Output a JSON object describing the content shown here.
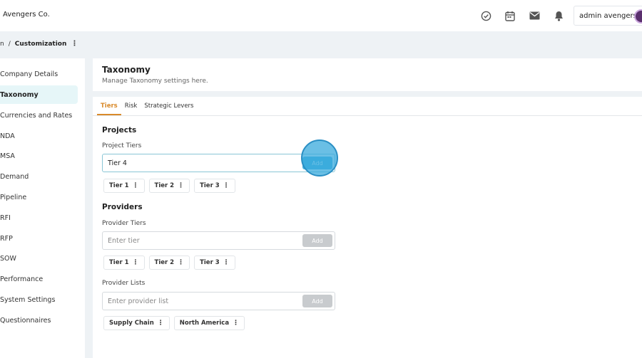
{
  "app": {
    "company": "Avengers Co.",
    "user": "admin avengers"
  },
  "top_icons": [
    "check-circle-icon",
    "calendar-icon",
    "mail-icon",
    "bell-icon"
  ],
  "breadcrumb": {
    "prev": "n",
    "sep": "/",
    "current": "Customization",
    "menu": "⋮"
  },
  "sidebar": {
    "items": [
      {
        "label": "Company Details"
      },
      {
        "label": "Taxonomy",
        "active": true
      },
      {
        "label": "Currencies and Rates"
      },
      {
        "label": "NDA"
      },
      {
        "label": "MSA"
      },
      {
        "label": "Demand"
      },
      {
        "label": "Pipeline"
      },
      {
        "label": "RFI"
      },
      {
        "label": "RFP"
      },
      {
        "label": "SOW"
      },
      {
        "label": "Performance"
      },
      {
        "label": "System Settings"
      },
      {
        "label": "Questionnaires"
      }
    ]
  },
  "header": {
    "title": "Taxonomy",
    "subtitle": "Manage Taxonomy settings here."
  },
  "tabs": [
    {
      "label": "Tiers",
      "active": true
    },
    {
      "label": "Risk"
    },
    {
      "label": "Strategic Levers"
    }
  ],
  "projects": {
    "title": "Projects",
    "tiers_label": "Project Tiers",
    "input_value": "Tier 4",
    "add_label": "Add",
    "chips": [
      "Tier 1",
      "Tier 2",
      "Tier 3"
    ]
  },
  "providers": {
    "title": "Providers",
    "tiers_label": "Provider Tiers",
    "tiers_placeholder": "Enter tier",
    "add_label": "Add",
    "chips": [
      "Tier 1",
      "Tier 2",
      "Tier 3"
    ],
    "lists_label": "Provider Lists",
    "lists_placeholder": "Enter provider list",
    "lists_add_label": "Add",
    "list_chips": [
      "Supply Chain",
      "North America"
    ]
  },
  "colors": {
    "accent": "#d98a2a",
    "active_bg": "#e6f6f8",
    "click_highlight": "#43b4e0"
  }
}
